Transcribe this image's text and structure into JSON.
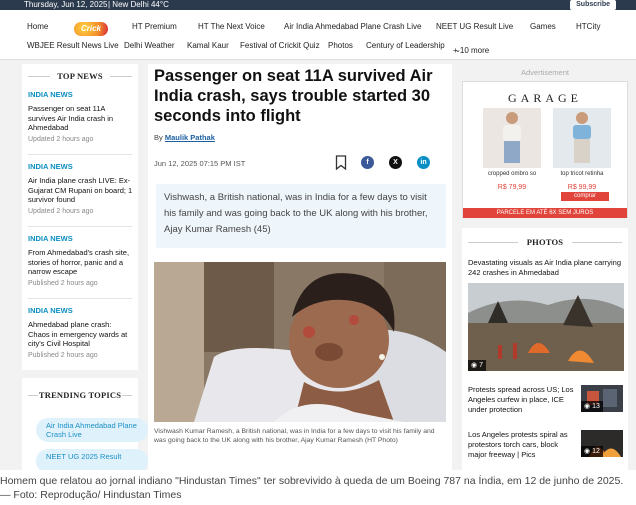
{
  "topbar": {
    "date": "Thursday, Jun 12, 2025",
    "weather": "| New Delhi 44°C",
    "subscribe": "Subscribe"
  },
  "nav": {
    "row1": [
      "Home",
      "HT Premium",
      "HT The Next Voice",
      "Air India Ahmedabad Plane Crash Live",
      "NEET UG Result Live",
      "Games",
      "HTCity"
    ],
    "cricket_logo": "Crick",
    "row2": [
      "WBJEE Result News Live",
      "Delhi Weather",
      "Kamal Kaur",
      "Festival of Crickit Quiz",
      "Photos",
      "Century of Leadership",
      "+ 10 more"
    ]
  },
  "top_news": {
    "heading": "TOP NEWS",
    "items": [
      {
        "tag": "INDIA NEWS",
        "title": "Passenger on seat 11A survives Air India crash in Ahmedabad",
        "time": "Updated 2 hours ago"
      },
      {
        "tag": "INDIA NEWS",
        "title": "Air India plane crash LIVE: Ex-Gujarat CM Rupani on board; 1 survivor found",
        "time": "Updated 2 hours ago"
      },
      {
        "tag": "INDIA NEWS",
        "title": "From Ahmedabad's crash site, stories of horror, panic and a narrow escape",
        "time": "Published 2 hours ago"
      },
      {
        "tag": "INDIA NEWS",
        "title": "Ahmedabad plane crash: Chaos in emergency wards at city's Civil Hospital",
        "time": "Published 2 hours ago"
      }
    ]
  },
  "trending": {
    "heading": "TRENDING TOPICS",
    "pills": [
      "Air India Ahmedabad Plane Crash Live",
      "NEET UG 2025 Result"
    ]
  },
  "article": {
    "headline": "Passenger on seat 11A survived Air India crash, says trouble started 30 seconds into flight",
    "by": "By",
    "author": "Maulik Pathak",
    "dateline": "Jun 12, 2025 07:15 PM IST",
    "summary": "Vishwash, a British national, was in India for a few days to visit his family and was going back to the UK along with his brother, Ajay Kumar Ramesh (45)",
    "caption": "Vishwash Kumar Ramesh, a British national, was in India for a few days to visit his family and was going back to the UK along with his brother, Ajay Kumar Ramesh (HT Photo)"
  },
  "ad": {
    "label": "Advertisement",
    "brand": "GARAGE",
    "products": [
      {
        "name": "cropped ombro so",
        "price": "R$ 79,99"
      },
      {
        "name": "top tricot retinha",
        "price": "R$ 99,99"
      }
    ],
    "buy": "comprar",
    "footer": "PARCELE EM ATÉ 6X SEM JUROS"
  },
  "photos": {
    "heading": "PHOTOS",
    "lead": "Devastating visuals as Air India plane carrying 242 crashes in Ahmedabad",
    "lead_count": "7",
    "stories": [
      {
        "title": "Protests spread across US; Los Angeles curfew in place, ICE under protection",
        "count": "13"
      },
      {
        "title": "Los Angeles protests spiral as protestors torch cars, block major freeway | Pics",
        "count": "12"
      }
    ]
  },
  "bottom_caption": "Homem que relatou ao jornal indiano \"Hindustan Times\" ter sobrevivido à queda de um Boeing 787 na Índia, em 12 de junho de 2025. — Foto: Reprodução/ Hindustan Times",
  "colors": {
    "accent": "#0a8fc4",
    "topbar": "#2b3a4d",
    "ad_red": "#e0443a"
  }
}
